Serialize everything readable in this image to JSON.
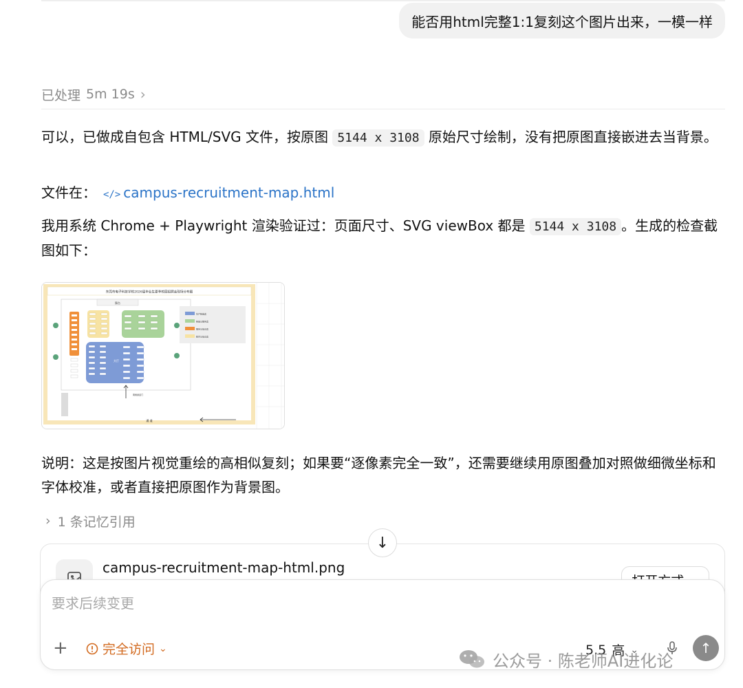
{
  "user_message": "能否用html完整1:1复刻这个图片出来，一模一样",
  "processed": {
    "label": "已处理",
    "duration": "5m 19s"
  },
  "para1": {
    "before": "可以，已做成自包含 HTML/SVG 文件，按原图",
    "code": "5144 x 3108",
    "after": "原始尺寸绘制，没有把原图直接嵌进去当背景。"
  },
  "file_line": {
    "label": "文件在：",
    "icon": "</>",
    "link": "campus-recruitment-map.html"
  },
  "para3": {
    "before": "我用系统 Chrome + Playwright 渲染验证过：页面尺寸、SVG viewBox 都是",
    "code": "5144 x 3108",
    "after": "。生成的检查截图如下："
  },
  "thumbnail": {
    "title": "东莞市电子科技学校2026届毕业生夏季校园招聘会现场分布图",
    "stage": "舞台",
    "hall": "大厅",
    "entrance": "南侧通道门",
    "road": "通 道",
    "legend": [
      {
        "label": "生产制造类",
        "color": "#7e9bd6"
      },
      {
        "label": "制造与服务类",
        "color": "#a9d39a"
      },
      {
        "label": "服务与信息类",
        "color": "#f0903a"
      },
      {
        "label": "教育与信息类",
        "color": "#f7e3a3"
      }
    ]
  },
  "para4": "说明：这是按图片视觉重绘的高相似复刻；如果要“逐像素完全一致”，还需要继续用原图叠加对照做细微坐标和字体校准，或者直接把原图作为背景图。",
  "memory": "1 条记忆引用",
  "file_card": {
    "name": "campus-recruitment-map-html.png",
    "open_label": "打开方式"
  },
  "composer": {
    "placeholder": "要求后续变更",
    "access": "完全访问",
    "model": "5.5",
    "level": "高"
  },
  "watermark": "公众号 · 陈老师AI进化论",
  "colors": {
    "accent_orange": "#d2691e",
    "link_blue": "#2a73c7"
  }
}
